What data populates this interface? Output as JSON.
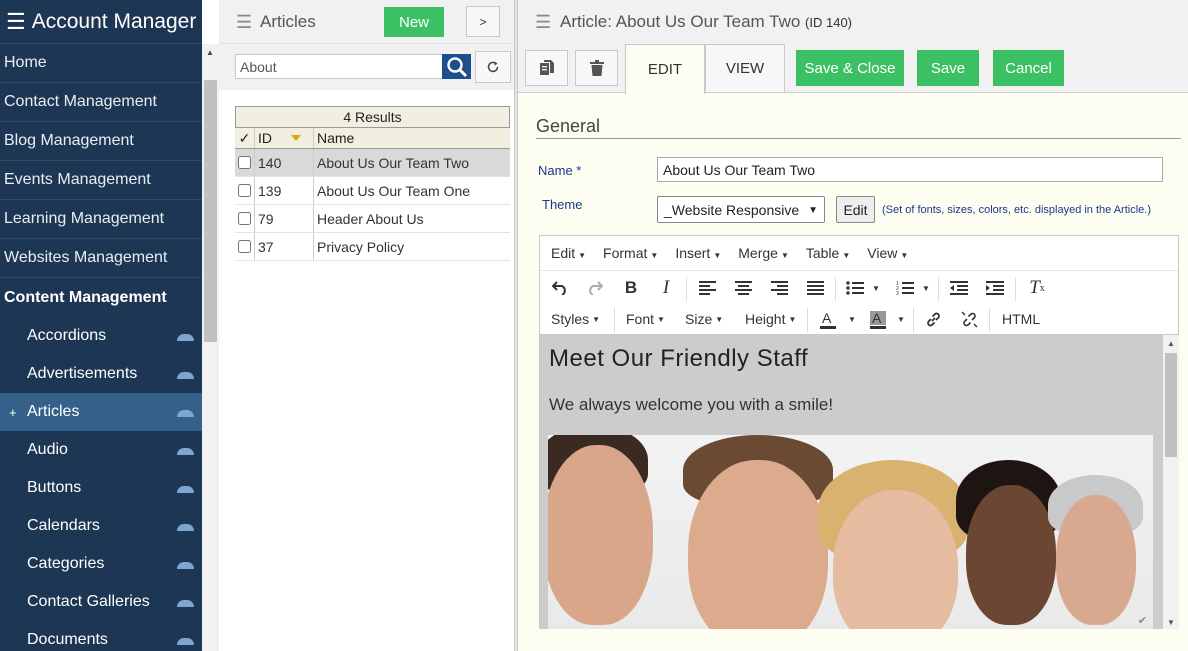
{
  "sidebar": {
    "title": "Account Manager",
    "items": [
      {
        "label": "Home"
      },
      {
        "label": "Contact Management"
      },
      {
        "label": "Blog Management"
      },
      {
        "label": "Events Management"
      },
      {
        "label": "Learning Management"
      },
      {
        "label": "Websites Management"
      },
      {
        "label": "Content Management"
      }
    ],
    "sub_items": [
      {
        "label": "Accordions"
      },
      {
        "label": "Advertisements"
      },
      {
        "label": "Articles",
        "active": true,
        "marker": "+"
      },
      {
        "label": "Audio"
      },
      {
        "label": "Buttons"
      },
      {
        "label": "Calendars"
      },
      {
        "label": "Categories"
      },
      {
        "label": "Contact Galleries"
      },
      {
        "label": "Documents"
      }
    ]
  },
  "list": {
    "title": "Articles",
    "new_label": "New",
    "arrow_label": ">",
    "search_value": "About",
    "results_label": "4 Results",
    "columns": {
      "check": "✓",
      "id": "ID",
      "name": "Name"
    },
    "rows": [
      {
        "id": "140",
        "name": "About Us Our Team Two",
        "selected": true
      },
      {
        "id": "139",
        "name": "About Us Our Team One"
      },
      {
        "id": "79",
        "name": "Header About Us"
      },
      {
        "id": "37",
        "name": "Privacy Policy"
      }
    ]
  },
  "article": {
    "title": "Article: About Us Our Team Two",
    "id_label": "(ID 140)",
    "tabs": {
      "edit": "EDIT",
      "view": "VIEW"
    },
    "buttons": {
      "save_close": "Save & Close",
      "save": "Save",
      "cancel": "Cancel"
    },
    "section": "General",
    "name_label": "Name *",
    "name_value": "About Us Our Team Two",
    "theme_label": "Theme",
    "theme_value": "_Website Responsive",
    "theme_edit": "Edit",
    "theme_note": "(Set of fonts, sizes, colors, etc. displayed in the Article.)"
  },
  "editor": {
    "menus": [
      "Edit",
      "Format",
      "Insert",
      "Merge",
      "Table",
      "View"
    ],
    "toolbar_row2": {
      "styles": "Styles",
      "font": "Font",
      "size": "Size",
      "height": "Height",
      "html": "HTML"
    },
    "content": {
      "heading": "Meet Our Friendly Staff",
      "subtext": "We always welcome you with a smile!"
    }
  },
  "colors": {
    "sidebar_bg": "#1d3653",
    "sidebar_active": "#35608a",
    "green": "#3cc064",
    "search_blue": "#1f4f8a"
  }
}
